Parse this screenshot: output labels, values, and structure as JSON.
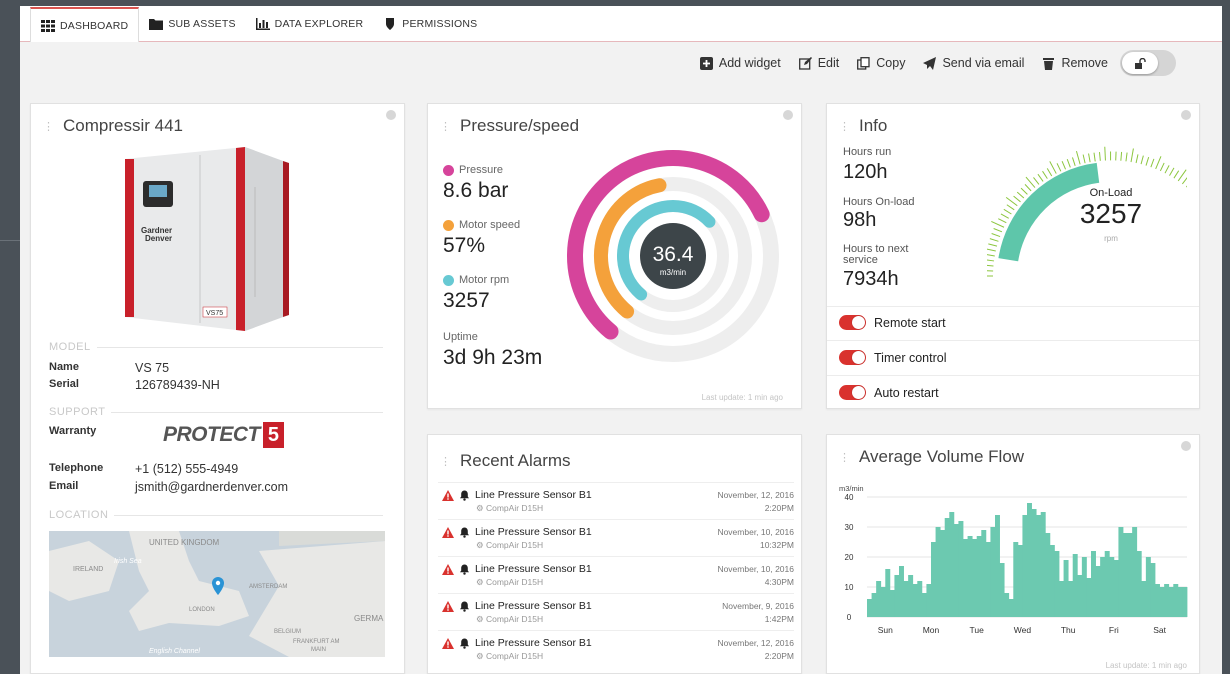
{
  "tabs": [
    {
      "label": "DASHBOARD",
      "icon": "grid-icon"
    },
    {
      "label": "SUB ASSETS",
      "icon": "folder-icon"
    },
    {
      "label": "DATA EXPLORER",
      "icon": "bar-chart-icon"
    },
    {
      "label": "PERMISSIONS",
      "icon": "shield-icon"
    }
  ],
  "toolbar": {
    "add_widget": "Add widget",
    "edit": "Edit",
    "copy": "Copy",
    "send": "Send via email",
    "remove": "Remove"
  },
  "compressor": {
    "title": "Compressir 441",
    "model_head": "MODEL",
    "name_label": "Name",
    "name_value": "VS 75",
    "serial_label": "Serial",
    "serial_value": "126789439-NH",
    "support_head": "SUPPORT",
    "warranty_label": "Warranty",
    "warranty_logo": "PROTECT",
    "warranty_years": "5",
    "telephone_label": "Telephone",
    "telephone_value": "+1 (512) 555-4949",
    "email_label": "Email",
    "email_value": "jsmith@gardnerdenver.com",
    "location_head": "LOCATION",
    "brand_top": "Gardner",
    "brand_bottom": "Denver",
    "unit_label": "VS75",
    "map_labels": [
      "UNITED KINGDOM",
      "Irish Sea",
      "IRELAND",
      "LONDON",
      "AMSTERDAM",
      "BELGIUM",
      "GERMA",
      "FRANKFURT AM",
      "MAIN",
      "English Channel"
    ]
  },
  "pressure": {
    "title": "Pressure/speed",
    "pressure_label": "Pressure",
    "pressure_value": "8.6 bar",
    "speed_label": "Motor speed",
    "speed_value": "57%",
    "rpm_label": "Motor rpm",
    "rpm_value": "3257",
    "uptime_label": "Uptime",
    "uptime_value": "3d 9h 23m",
    "center_value": "36.4",
    "center_unit": "m3/min",
    "last_update": "Last update: 1 min ago",
    "colors": {
      "pressure": "#d6449b",
      "speed": "#f4a13b",
      "rpm": "#67c9d3",
      "center": "#3d4549"
    },
    "ring_fractions": {
      "pressure": 0.57,
      "speed": 0.36,
      "rpm": 0.52
    }
  },
  "info": {
    "title": "Info",
    "hours_run_label": "Hours run",
    "hours_run_value": "120h",
    "onload_label": "Hours On-load",
    "onload_value": "98h",
    "next_label_1": "Hours to next",
    "next_label_2": "service",
    "next_value": "7934h",
    "gauge_label": "On-Load",
    "gauge_value": "3257",
    "gauge_unit": "rpm",
    "gauge_color": "#5ec6aa",
    "toggles": [
      "Remote start",
      "Timer control",
      "Auto restart"
    ]
  },
  "alarms": {
    "title": "Recent Alarms",
    "items": [
      {
        "name": "Line Pressure Sensor B1",
        "source": "CompAir D15H",
        "date": "November, 12, 2016",
        "time": "2:20PM"
      },
      {
        "name": "Line Pressure Sensor B1",
        "source": "CompAir D15H",
        "date": "November, 10, 2016",
        "time": "10:32PM"
      },
      {
        "name": "Line Pressure Sensor B1",
        "source": "CompAir D15H",
        "date": "November, 10, 2016",
        "time": "4:30PM"
      },
      {
        "name": "Line Pressure Sensor B1",
        "source": "CompAir D15H",
        "date": "November, 9, 2016",
        "time": "1:42PM"
      },
      {
        "name": "Line Pressure Sensor B1",
        "source": "CompAir D15H",
        "date": "November, 12, 2016",
        "time": "2:20PM"
      }
    ]
  },
  "chart_data": {
    "type": "area",
    "title": "Average Volume Flow",
    "ylabel": "m3/min",
    "ylim": [
      0,
      40
    ],
    "yticks": [
      0,
      10,
      20,
      30,
      40
    ],
    "categories": [
      "Sun",
      "Mon",
      "Tue",
      "Wed",
      "Thu",
      "Fri",
      "Sat"
    ],
    "color": "#6cc9b0",
    "grid": true,
    "last_update": "Last update: 1 min ago",
    "values": [
      6,
      8,
      12,
      10,
      16,
      9,
      14,
      17,
      12,
      14,
      11,
      12,
      8,
      11,
      25,
      30,
      29,
      33,
      35,
      31,
      32,
      26,
      27,
      26,
      27,
      29,
      25,
      30,
      34,
      18,
      8,
      6,
      25,
      24,
      34,
      38,
      36,
      34,
      35,
      28,
      24,
      22,
      12,
      19,
      12,
      21,
      14,
      20,
      13,
      22,
      17,
      20,
      22,
      20,
      19,
      30,
      28,
      28,
      30,
      22,
      12,
      20,
      18,
      11,
      10,
      11,
      10,
      11,
      10,
      10
    ]
  }
}
